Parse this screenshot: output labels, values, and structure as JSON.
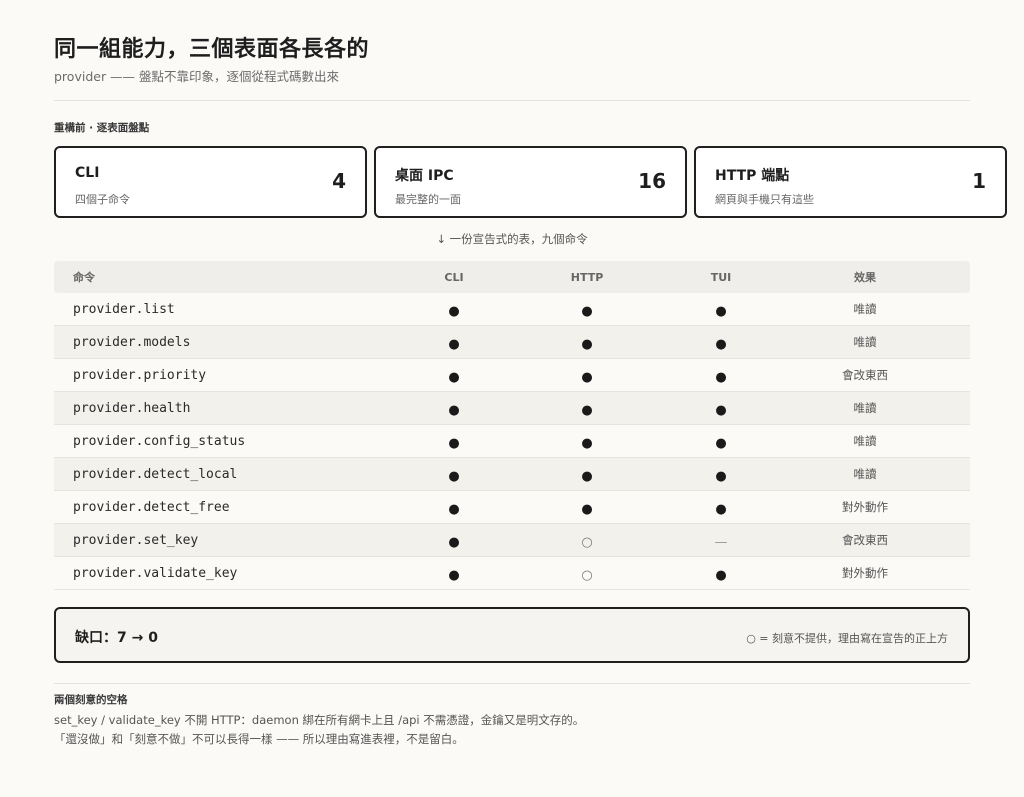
{
  "header": {
    "title": "同一組能力，三個表面各長各的",
    "subtitle": "provider —— 盤點不靠印象，逐個從程式碼數出來"
  },
  "before": {
    "label": "重構前 · 逐表面盤點",
    "cards": [
      {
        "name": "CLI",
        "desc": "四個子命令",
        "count": "4"
      },
      {
        "name": "桌面 IPC",
        "desc": "最完整的一面",
        "count": "16"
      },
      {
        "name": "HTTP 端點",
        "desc": "網頁與手機只有這些",
        "count": "1"
      }
    ]
  },
  "arrow_note": "↓ 一份宣告式的表，九個命令",
  "table": {
    "headers": {
      "command": "命令",
      "cli": "CLI",
      "http": "HTTP",
      "tui": "TUI",
      "effect": "效果"
    },
    "rows": [
      {
        "command": "provider.list",
        "cli": "●",
        "http": "●",
        "tui": "●",
        "effect": "唯讀"
      },
      {
        "command": "provider.models",
        "cli": "●",
        "http": "●",
        "tui": "●",
        "effect": "唯讀"
      },
      {
        "command": "provider.priority",
        "cli": "●",
        "http": "●",
        "tui": "●",
        "effect": "會改東西"
      },
      {
        "command": "provider.health",
        "cli": "●",
        "http": "●",
        "tui": "●",
        "effect": "唯讀"
      },
      {
        "command": "provider.config_status",
        "cli": "●",
        "http": "●",
        "tui": "●",
        "effect": "唯讀"
      },
      {
        "command": "provider.detect_local",
        "cli": "●",
        "http": "●",
        "tui": "●",
        "effect": "唯讀"
      },
      {
        "command": "provider.detect_free",
        "cli": "●",
        "http": "●",
        "tui": "●",
        "effect": "對外動作"
      },
      {
        "command": "provider.set_key",
        "cli": "●",
        "http": "○",
        "tui": "—",
        "effect": "會改東西"
      },
      {
        "command": "provider.validate_key",
        "cli": "●",
        "http": "○",
        "tui": "●",
        "effect": "對外動作"
      }
    ]
  },
  "gap": {
    "label": "缺口：7 → 0",
    "note": "○ = 刻意不提供，理由寫在宣告的正上方"
  },
  "footer": {
    "title": "兩個刻意的空格",
    "line1": "set_key / validate_key 不開 HTTP：daemon 綁在所有網卡上且 /api 不需憑證，金鑰又是明文存的。",
    "line2": "「還沒做」和「刻意不做」不可以長得一樣 —— 所以理由寫進表裡，不是留白。"
  },
  "colors": {
    "background": "#fbfaf7",
    "border": "#1f1f1f",
    "row_alt": "#f3f1ec",
    "header_bg": "#f0eeea"
  }
}
